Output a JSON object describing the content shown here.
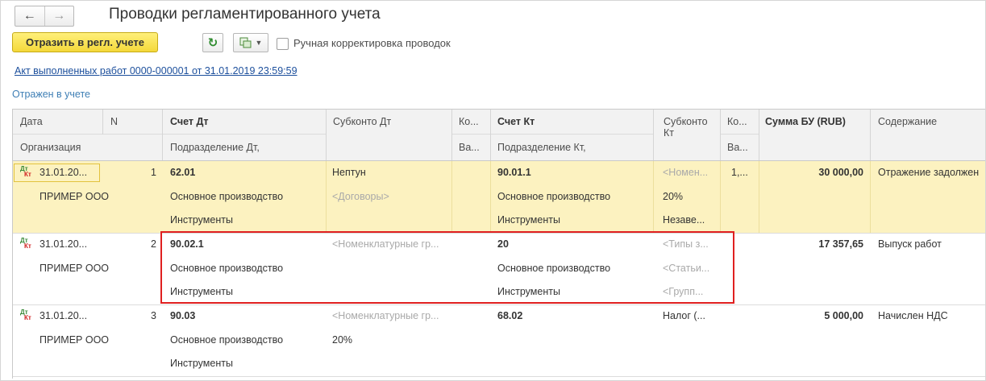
{
  "window": {
    "back_icon": "arrow-left-icon",
    "forward_icon": "arrow-right-icon",
    "title": "Проводки регламентированного учета"
  },
  "toolbar": {
    "post_button": "Отразить в регл. учете",
    "refresh_icon": "refresh-icon",
    "more_icon": "table-actions-icon",
    "manual_checkbox_label": "Ручная корректировка проводок",
    "manual_checked": false
  },
  "document_link": "Акт выполненных работ 0000-000001 от 31.01.2019 23:59:59",
  "status_text": "Отражен в учете",
  "colors": {
    "selected_row": "#fcf2c0",
    "post_button": "#f4d83a",
    "highlight_frame": "#e02020",
    "link": "#1c4f9c"
  },
  "table": {
    "headers": {
      "date": "Дата",
      "n": "N",
      "debit_account": "Счет Дт",
      "debit_subconto": "Субконто Дт",
      "debit_qty": "Ко...",
      "credit_account": "Счет Кт",
      "credit_subconto": "Субконто Кт",
      "credit_qty": "Ко...",
      "amount": "Сумма БУ (RUB)",
      "content": "Содержание",
      "organization": "Организация",
      "debit_division": "Подразделение Дт,",
      "debit_currency": "Ва...",
      "credit_division": "Подразделение Кт,",
      "credit_currency": "Ва..."
    },
    "rows": [
      {
        "date": "31.01.20...",
        "n": "1",
        "organization": "ПРИМЕР ООО",
        "debit_account": "62.01",
        "debit_line2": "Основное производство",
        "debit_line3": "Инструменты",
        "debit_sub1": "Нептун",
        "debit_sub2": "<Договоры>",
        "debit_qty": "",
        "credit_account": "90.01.1",
        "credit_line2": "Основное производство",
        "credit_line3": "Инструменты",
        "credit_sub1": "<Номен...",
        "credit_sub2": "20%",
        "credit_sub3": "Незаве...",
        "credit_qty": "1,...",
        "amount": "30 000,00",
        "content": "Отражение задолжен",
        "selected": true
      },
      {
        "date": "31.01.20...",
        "n": "2",
        "organization": "ПРИМЕР ООО",
        "debit_account": "90.02.1",
        "debit_line2": "Основное производство",
        "debit_line3": "Инструменты",
        "debit_sub1": "<Номенклатурные гр...",
        "debit_sub2": "",
        "debit_qty": "",
        "credit_account": "20",
        "credit_line2": "Основное производство",
        "credit_line3": "Инструменты",
        "credit_sub1": "<Типы з...",
        "credit_sub2": "<Статьи...",
        "credit_sub3": "<Групп...",
        "credit_qty": "",
        "amount": "17 357,65",
        "content": "Выпуск работ",
        "selected": false
      },
      {
        "date": "31.01.20...",
        "n": "3",
        "organization": "ПРИМЕР ООО",
        "debit_account": "90.03",
        "debit_line2": "Основное производство",
        "debit_line3": "Инструменты",
        "debit_sub1": "<Номенклатурные гр...",
        "debit_sub2": "20%",
        "debit_qty": "",
        "credit_account": "68.02",
        "credit_line2": "",
        "credit_line3": "",
        "credit_sub1": "Налог (...",
        "credit_sub2": "",
        "credit_sub3": "",
        "credit_qty": "",
        "amount": "5 000,00",
        "content": "Начислен НДС",
        "selected": false
      }
    ]
  }
}
